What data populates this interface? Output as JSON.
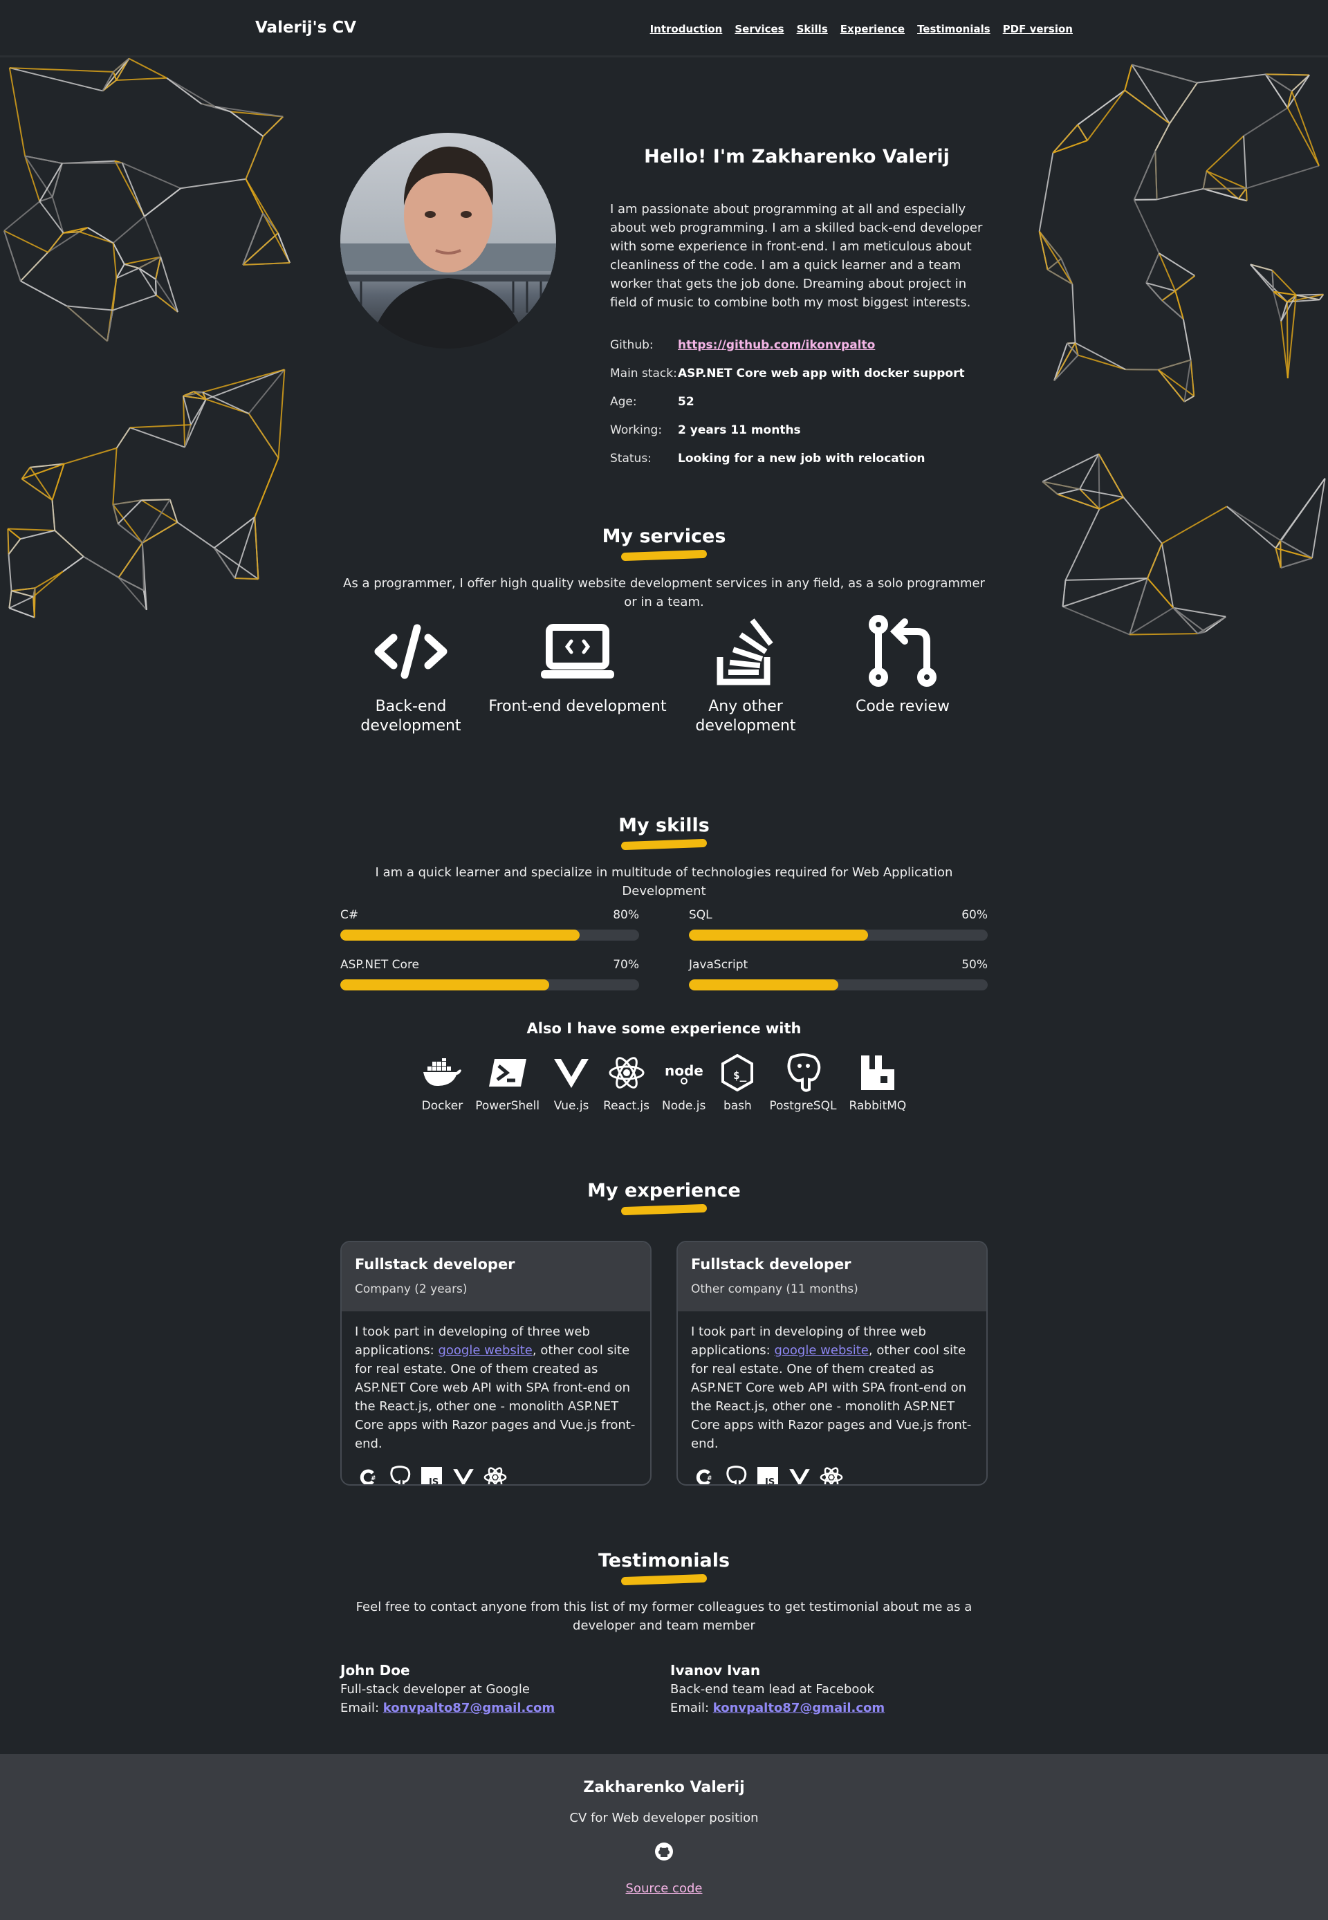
{
  "nav": {
    "brand": "Valerij's CV",
    "links": [
      "Introduction",
      "Services",
      "Skills",
      "Experience",
      "Testimonials",
      "PDF version"
    ]
  },
  "intro": {
    "title": "Hello! I'm Zakharenko Valerij",
    "text": "I am passionate about programming at all and especially about web programming. I am a skilled back-end developer with some experience in front-end. I am meticulous about cleanliness of the code. I am a quick learner and a team worker that gets the job done. Dreaming about project in field of music to combine both my most biggest interests.",
    "facts": [
      {
        "label": "Github:",
        "value": "https://github.com/ikonvpalto"
      },
      {
        "label": "Main stack:",
        "value": "ASP.NET Core web app with docker support"
      },
      {
        "label": "Age:",
        "value": "52"
      },
      {
        "label": "Working:",
        "value": "2 years 11 months"
      },
      {
        "label": "Status:",
        "value": "Looking for a new job with relocation"
      }
    ]
  },
  "services": {
    "title": "My services",
    "description": "As a programmer, I offer high quality website development services in any field, as a solo programmer or in a team.",
    "items": [
      {
        "label": "Back-end development",
        "icon": "code-icon"
      },
      {
        "label": "Front-end development",
        "icon": "laptop-code-icon"
      },
      {
        "label": "Any other development",
        "icon": "stack-overflow-icon"
      },
      {
        "label": "Code review",
        "icon": "pull-request-icon"
      }
    ]
  },
  "skills": {
    "title": "My skills",
    "description": "I am a quick learner and specialize in multitude of technologies required for Web Application Development",
    "items": [
      {
        "name": "C#",
        "percent_label": "80%",
        "level": 0.8
      },
      {
        "name": "SQL",
        "percent_label": "60%",
        "level": 0.6
      },
      {
        "name": "ASP.NET Core",
        "percent_label": "70%",
        "level": 0.7
      },
      {
        "name": "JavaScript",
        "percent_label": "50%",
        "level": 0.5
      }
    ],
    "also_title": "Also I have some experience with",
    "tools": [
      "Docker",
      "PowerShell",
      "Vue.js",
      "React.js",
      "Node.js",
      "bash",
      "PostgreSQL",
      "RabbitMQ"
    ]
  },
  "experience": {
    "title": "My experience",
    "jobs": [
      {
        "title": "Fullstack developer",
        "company": "Company (2 years)",
        "text_before": "I took part in developing of three web applications: ",
        "link": "google website",
        "text_after": ", other cool site for real estate. One of them created as ASP.NET Core web API with SPA front-end on the React.js, other one - monolith ASP.NET Core apps with Razor pages and Vue.js front-end."
      },
      {
        "title": "Fullstack developer",
        "company": "Other company (11 months)",
        "text_before": "I took part in developing of three web applications: ",
        "link": "google website",
        "text_after": ", other cool site for real estate. One of them created as ASP.NET Core web API with SPA front-end on the React.js, other one - monolith ASP.NET Core apps with Razor pages and Vue.js front-end."
      }
    ]
  },
  "testimonials": {
    "title": "Testimonials",
    "description": "Feel free to contact anyone from this list of my former colleagues to get testimonial about me as a developer and team member",
    "people": [
      {
        "name": "John Doe",
        "role": "Full-stack developer at Google",
        "email_label": "Email: ",
        "email": "konvpalto87@gmail.com"
      },
      {
        "name": "Ivanov Ivan",
        "role": "Back-end team lead at Facebook",
        "email_label": "Email: ",
        "email": "konvpalto87@gmail.com"
      }
    ]
  },
  "footer": {
    "name": "Zakharenko Valerij",
    "subtitle": "CV for Web developer position",
    "source_link": "Source code"
  },
  "colors": {
    "background": "#212529",
    "accent": "#f2b90f",
    "link_pink": "#f4b5e6",
    "link_purple": "#8e87f2",
    "panel": "#3a3d42"
  }
}
